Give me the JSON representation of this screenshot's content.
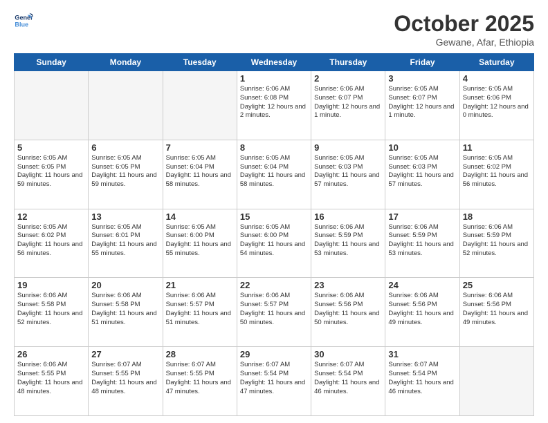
{
  "logo": {
    "line1": "General",
    "line2": "Blue"
  },
  "title": "October 2025",
  "subtitle": "Gewane, Afar, Ethiopia",
  "days_of_week": [
    "Sunday",
    "Monday",
    "Tuesday",
    "Wednesday",
    "Thursday",
    "Friday",
    "Saturday"
  ],
  "weeks": [
    [
      {
        "day": "",
        "info": ""
      },
      {
        "day": "",
        "info": ""
      },
      {
        "day": "",
        "info": ""
      },
      {
        "day": "1",
        "info": "Sunrise: 6:06 AM\nSunset: 6:08 PM\nDaylight: 12 hours\nand 2 minutes."
      },
      {
        "day": "2",
        "info": "Sunrise: 6:06 AM\nSunset: 6:07 PM\nDaylight: 12 hours\nand 1 minute."
      },
      {
        "day": "3",
        "info": "Sunrise: 6:05 AM\nSunset: 6:07 PM\nDaylight: 12 hours\nand 1 minute."
      },
      {
        "day": "4",
        "info": "Sunrise: 6:05 AM\nSunset: 6:06 PM\nDaylight: 12 hours\nand 0 minutes."
      }
    ],
    [
      {
        "day": "5",
        "info": "Sunrise: 6:05 AM\nSunset: 6:05 PM\nDaylight: 11 hours\nand 59 minutes."
      },
      {
        "day": "6",
        "info": "Sunrise: 6:05 AM\nSunset: 6:05 PM\nDaylight: 11 hours\nand 59 minutes."
      },
      {
        "day": "7",
        "info": "Sunrise: 6:05 AM\nSunset: 6:04 PM\nDaylight: 11 hours\nand 58 minutes."
      },
      {
        "day": "8",
        "info": "Sunrise: 6:05 AM\nSunset: 6:04 PM\nDaylight: 11 hours\nand 58 minutes."
      },
      {
        "day": "9",
        "info": "Sunrise: 6:05 AM\nSunset: 6:03 PM\nDaylight: 11 hours\nand 57 minutes."
      },
      {
        "day": "10",
        "info": "Sunrise: 6:05 AM\nSunset: 6:03 PM\nDaylight: 11 hours\nand 57 minutes."
      },
      {
        "day": "11",
        "info": "Sunrise: 6:05 AM\nSunset: 6:02 PM\nDaylight: 11 hours\nand 56 minutes."
      }
    ],
    [
      {
        "day": "12",
        "info": "Sunrise: 6:05 AM\nSunset: 6:02 PM\nDaylight: 11 hours\nand 56 minutes."
      },
      {
        "day": "13",
        "info": "Sunrise: 6:05 AM\nSunset: 6:01 PM\nDaylight: 11 hours\nand 55 minutes."
      },
      {
        "day": "14",
        "info": "Sunrise: 6:05 AM\nSunset: 6:00 PM\nDaylight: 11 hours\nand 55 minutes."
      },
      {
        "day": "15",
        "info": "Sunrise: 6:05 AM\nSunset: 6:00 PM\nDaylight: 11 hours\nand 54 minutes."
      },
      {
        "day": "16",
        "info": "Sunrise: 6:06 AM\nSunset: 5:59 PM\nDaylight: 11 hours\nand 53 minutes."
      },
      {
        "day": "17",
        "info": "Sunrise: 6:06 AM\nSunset: 5:59 PM\nDaylight: 11 hours\nand 53 minutes."
      },
      {
        "day": "18",
        "info": "Sunrise: 6:06 AM\nSunset: 5:59 PM\nDaylight: 11 hours\nand 52 minutes."
      }
    ],
    [
      {
        "day": "19",
        "info": "Sunrise: 6:06 AM\nSunset: 5:58 PM\nDaylight: 11 hours\nand 52 minutes."
      },
      {
        "day": "20",
        "info": "Sunrise: 6:06 AM\nSunset: 5:58 PM\nDaylight: 11 hours\nand 51 minutes."
      },
      {
        "day": "21",
        "info": "Sunrise: 6:06 AM\nSunset: 5:57 PM\nDaylight: 11 hours\nand 51 minutes."
      },
      {
        "day": "22",
        "info": "Sunrise: 6:06 AM\nSunset: 5:57 PM\nDaylight: 11 hours\nand 50 minutes."
      },
      {
        "day": "23",
        "info": "Sunrise: 6:06 AM\nSunset: 5:56 PM\nDaylight: 11 hours\nand 50 minutes."
      },
      {
        "day": "24",
        "info": "Sunrise: 6:06 AM\nSunset: 5:56 PM\nDaylight: 11 hours\nand 49 minutes."
      },
      {
        "day": "25",
        "info": "Sunrise: 6:06 AM\nSunset: 5:56 PM\nDaylight: 11 hours\nand 49 minutes."
      }
    ],
    [
      {
        "day": "26",
        "info": "Sunrise: 6:06 AM\nSunset: 5:55 PM\nDaylight: 11 hours\nand 48 minutes."
      },
      {
        "day": "27",
        "info": "Sunrise: 6:07 AM\nSunset: 5:55 PM\nDaylight: 11 hours\nand 48 minutes."
      },
      {
        "day": "28",
        "info": "Sunrise: 6:07 AM\nSunset: 5:55 PM\nDaylight: 11 hours\nand 47 minutes."
      },
      {
        "day": "29",
        "info": "Sunrise: 6:07 AM\nSunset: 5:54 PM\nDaylight: 11 hours\nand 47 minutes."
      },
      {
        "day": "30",
        "info": "Sunrise: 6:07 AM\nSunset: 5:54 PM\nDaylight: 11 hours\nand 46 minutes."
      },
      {
        "day": "31",
        "info": "Sunrise: 6:07 AM\nSunset: 5:54 PM\nDaylight: 11 hours\nand 46 minutes."
      },
      {
        "day": "",
        "info": ""
      }
    ]
  ]
}
